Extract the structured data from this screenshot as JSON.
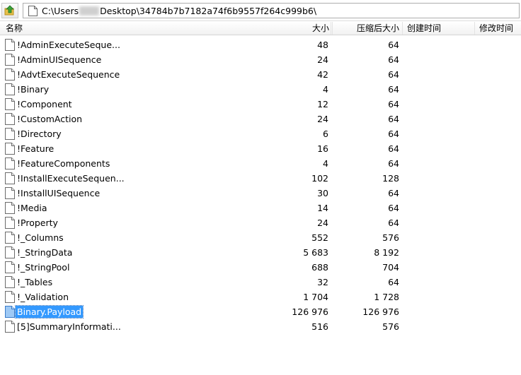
{
  "toolbar": {
    "up_icon": "folder-up-icon",
    "path_prefix": "C:\\Users",
    "path_suffix": "Desktop\\34784b7b7182a74f6b9557f264c999b6\\"
  },
  "columns": {
    "name": "名称",
    "size": "大小",
    "packed": "压缩后大小",
    "created": "创建时间",
    "modified": "修改时间"
  },
  "files": [
    {
      "name": "!AdminExecuteSeque...",
      "size": "48",
      "packed": "64"
    },
    {
      "name": "!AdminUISequence",
      "size": "24",
      "packed": "64"
    },
    {
      "name": "!AdvtExecuteSequence",
      "size": "42",
      "packed": "64"
    },
    {
      "name": "!Binary",
      "size": "4",
      "packed": "64"
    },
    {
      "name": "!Component",
      "size": "12",
      "packed": "64"
    },
    {
      "name": "!CustomAction",
      "size": "24",
      "packed": "64"
    },
    {
      "name": "!Directory",
      "size": "6",
      "packed": "64"
    },
    {
      "name": "!Feature",
      "size": "16",
      "packed": "64"
    },
    {
      "name": "!FeatureComponents",
      "size": "4",
      "packed": "64"
    },
    {
      "name": "!InstallExecuteSequen...",
      "size": "102",
      "packed": "128"
    },
    {
      "name": "!InstallUISequence",
      "size": "30",
      "packed": "64"
    },
    {
      "name": "!Media",
      "size": "14",
      "packed": "64"
    },
    {
      "name": "!Property",
      "size": "24",
      "packed": "64"
    },
    {
      "name": "!_Columns",
      "size": "552",
      "packed": "576"
    },
    {
      "name": "!_StringData",
      "size": "5 683",
      "packed": "8 192"
    },
    {
      "name": "!_StringPool",
      "size": "688",
      "packed": "704"
    },
    {
      "name": "!_Tables",
      "size": "32",
      "packed": "64"
    },
    {
      "name": "!_Validation",
      "size": "1 704",
      "packed": "1 728"
    },
    {
      "name": "Binary.Payload",
      "size": "126 976",
      "packed": "126 976",
      "selected": true
    },
    {
      "name": "[5]SummaryInformati...",
      "size": "516",
      "packed": "576"
    }
  ],
  "colors": {
    "selection": "#3399ff"
  }
}
